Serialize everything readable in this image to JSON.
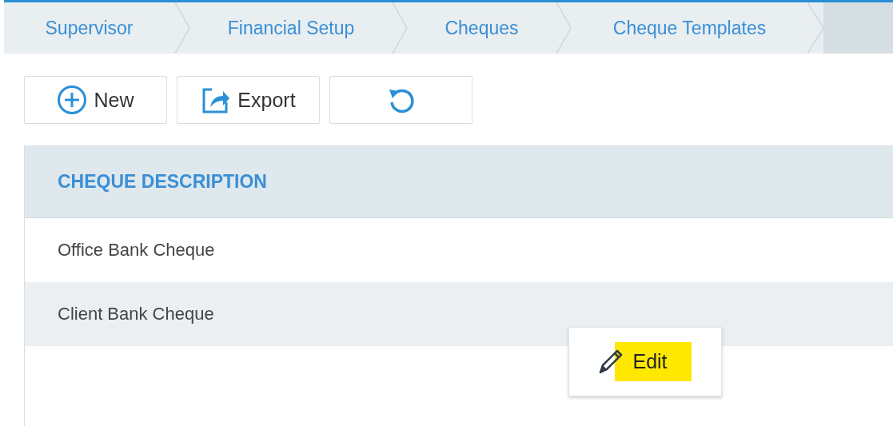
{
  "breadcrumb": [
    {
      "label": "Supervisor"
    },
    {
      "label": "Financial Setup"
    },
    {
      "label": "Cheques"
    },
    {
      "label": "Cheque Templates"
    }
  ],
  "toolbar": [
    {
      "kind": "new",
      "label": "New"
    },
    {
      "kind": "export",
      "label": "Export"
    },
    {
      "kind": "refresh"
    }
  ],
  "table": {
    "columns": [
      "CHEQUE DESCRIPTION"
    ],
    "rows": [
      {
        "cells": [
          "Office Bank Cheque"
        ],
        "selected": false
      },
      {
        "cells": [
          "Client Bank Cheque"
        ],
        "selected": true
      }
    ]
  },
  "context_menu": {
    "items": [
      {
        "kind": "edit",
        "label": "Edit",
        "highlighted": true
      }
    ]
  }
}
